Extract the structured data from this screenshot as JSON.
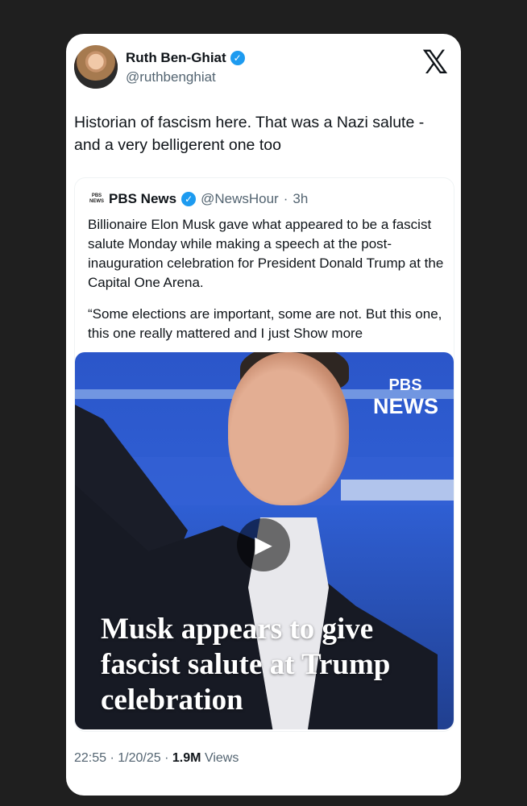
{
  "author": {
    "name": "Ruth Ben-Ghiat",
    "handle": "@ruthbenghiat",
    "verified_mark": "✓"
  },
  "platform_logo": "𝕏",
  "tweet": {
    "text": "Historian of fascism here. That was a Nazi salute - and a very belligerent one too"
  },
  "quoted": {
    "logo_text": "PBS NEWS",
    "name": "PBS News",
    "handle": "@NewsHour",
    "separator": "·",
    "time": "3h",
    "paragraph1": "Billionaire Elon Musk gave what appeared to be a fascist salute Monday while making a speech at the post-inauguration celebration for President Donald Trump at the Capital One Arena.",
    "paragraph2": "“Some elections are important, some are not. But this one, this one really mattered and I just",
    "show_more": "Show more",
    "media": {
      "brand_line1": "PBS",
      "brand_line2": "NEWS",
      "headline": "Musk appears to give fascist salute at Trump celebration",
      "play_icon": "▶"
    }
  },
  "footer": {
    "time": "22:55",
    "separator": "·",
    "date": "1/20/25",
    "views_count": "1.9M",
    "views_label": "Views"
  },
  "colors": {
    "background": "#1f1f1f",
    "card": "#ffffff",
    "verified": "#1d9bf0",
    "muted_text": "#536471",
    "primary_text": "#0f1419"
  }
}
